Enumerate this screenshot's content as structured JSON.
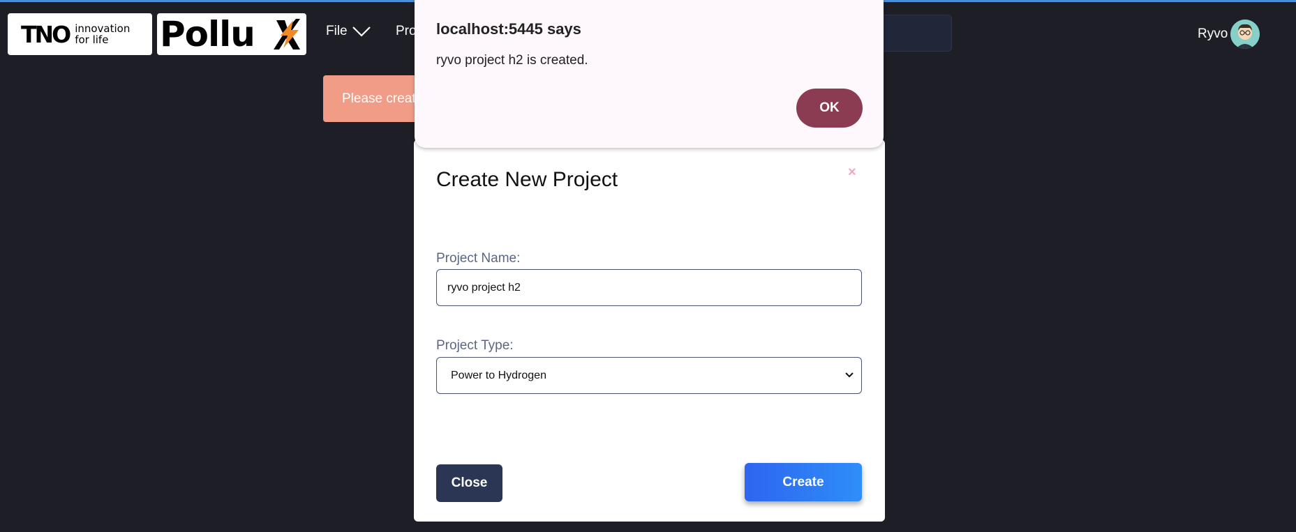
{
  "header": {
    "tno_logo": {
      "word": "TNO",
      "tagline_line1": "innovation",
      "tagline_line2": "for life"
    },
    "pollux_logo": {
      "word": "Pollu"
    },
    "nav": {
      "file_label": "File",
      "projects_label_partial": "Pro"
    },
    "user": {
      "name": "Ryvo"
    }
  },
  "banner": {
    "text": "Please creat"
  },
  "modal": {
    "title": "Create New Project",
    "close_icon": "×",
    "project_name_label": "Project Name:",
    "project_name_value": "ryvo project h2",
    "project_type_label": "Project Type:",
    "project_type_value": "Power to Hydrogen",
    "close_button": "Close",
    "create_button": "Create"
  },
  "alert": {
    "title": "localhost:5445 says",
    "message": "ryvo project h2 is created.",
    "ok_button": "OK"
  },
  "colors": {
    "background": "#1e1e26",
    "banner": "#f19c87",
    "ok_button": "#8b3c52",
    "create_button": "#2f7bf5",
    "close_button": "#2b3655"
  },
  "icons": {
    "file_menu": "chevron-down-icon",
    "select": "chevron-down-icon",
    "pollux_bolt": "lightning-bolt-icon",
    "avatar": "user-avatar-icon"
  }
}
